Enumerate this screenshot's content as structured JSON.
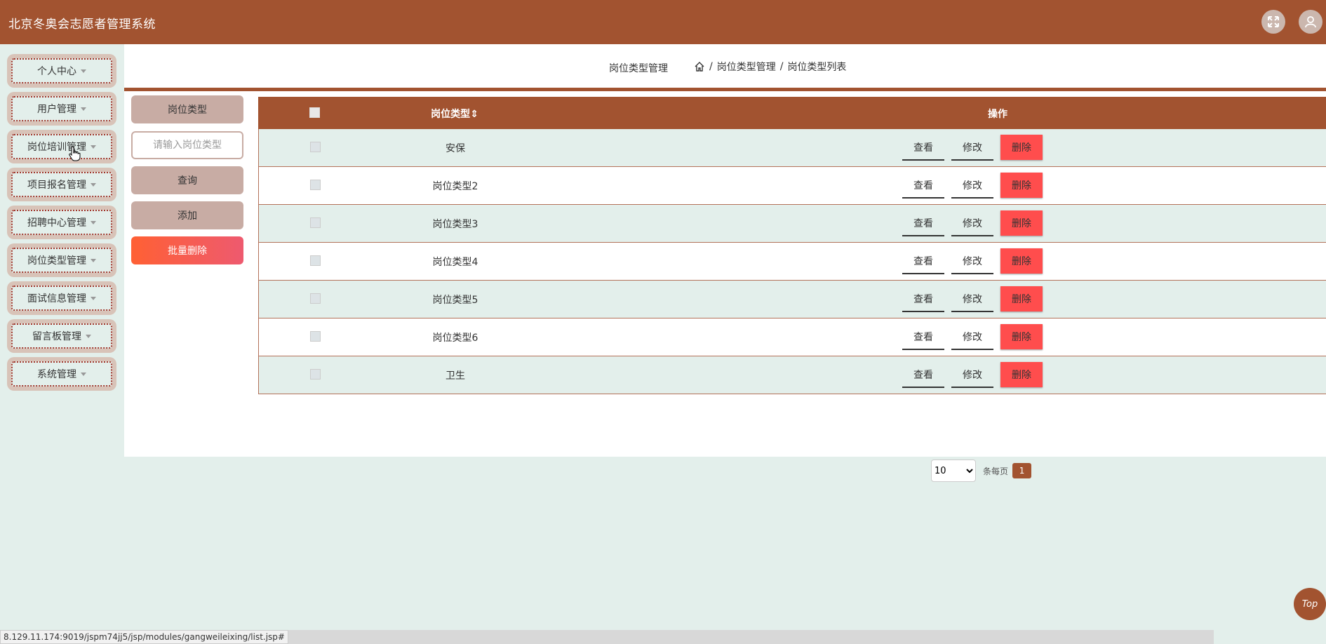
{
  "header": {
    "app_title": "北京冬奥会志愿者管理系统",
    "icons": [
      "fullscreen-icon",
      "user-icon"
    ]
  },
  "sidebar": {
    "items": [
      {
        "label": "个人中心"
      },
      {
        "label": "用户管理"
      },
      {
        "label": "岗位培训管理"
      },
      {
        "label": "项目报名管理"
      },
      {
        "label": "招聘中心管理"
      },
      {
        "label": "岗位类型管理"
      },
      {
        "label": "面试信息管理"
      },
      {
        "label": "留言板管理"
      },
      {
        "label": "系统管理"
      }
    ]
  },
  "breadcrumb": {
    "title": "岗位类型管理",
    "path_1": "岗位类型管理",
    "separator": "/",
    "path_2": "岗位类型列表"
  },
  "search": {
    "field_label": "岗位类型",
    "placeholder": "请输入岗位类型",
    "query_label": "查询",
    "add_label": "添加",
    "batch_delete_label": "批量删除"
  },
  "table": {
    "col_name": "岗位类型",
    "sort_icon": "⇕",
    "col_ops": "操作",
    "view_label": "查看",
    "edit_label": "修改",
    "delete_label": "删除",
    "rows": [
      {
        "name": "安保"
      },
      {
        "name": "岗位类型2"
      },
      {
        "name": "岗位类型3"
      },
      {
        "name": "岗位类型4"
      },
      {
        "name": "岗位类型5"
      },
      {
        "name": "岗位类型6"
      },
      {
        "name": "卫生"
      }
    ]
  },
  "pager": {
    "page_size": "10",
    "per_page_label": "条每页",
    "current_page": "1"
  },
  "status": {
    "url": "8.129.11.174:9019/jspm74jj5/jsp/modules/gangweileixing/list.jsp#"
  },
  "top_button": {
    "label": "Top"
  },
  "colors": {
    "brand": "#a25330",
    "background": "#e3efeb",
    "danger": "#ff4d4d"
  }
}
